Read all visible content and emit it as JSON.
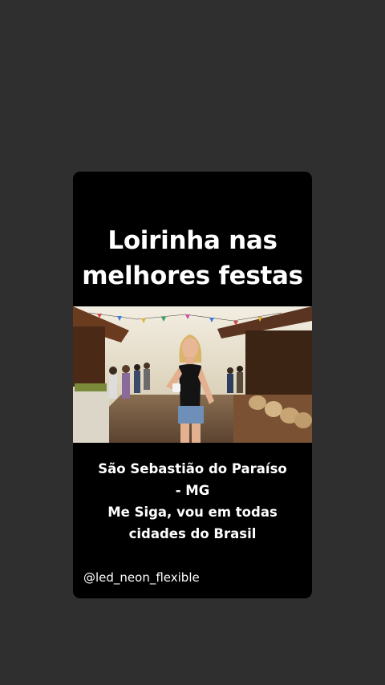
{
  "post": {
    "title_lines": [
      "Loirinha nas",
      "melhores festas"
    ],
    "caption_lines": [
      "São Sebastião do Paraíso",
      "- MG",
      "Me Siga, vou em todas",
      "cidades do Brasil"
    ],
    "handle": "@led_neon_flexible"
  },
  "colors": {
    "page_background": "#2f2f2f",
    "card_background": "#000000",
    "text": "#ffffff"
  }
}
